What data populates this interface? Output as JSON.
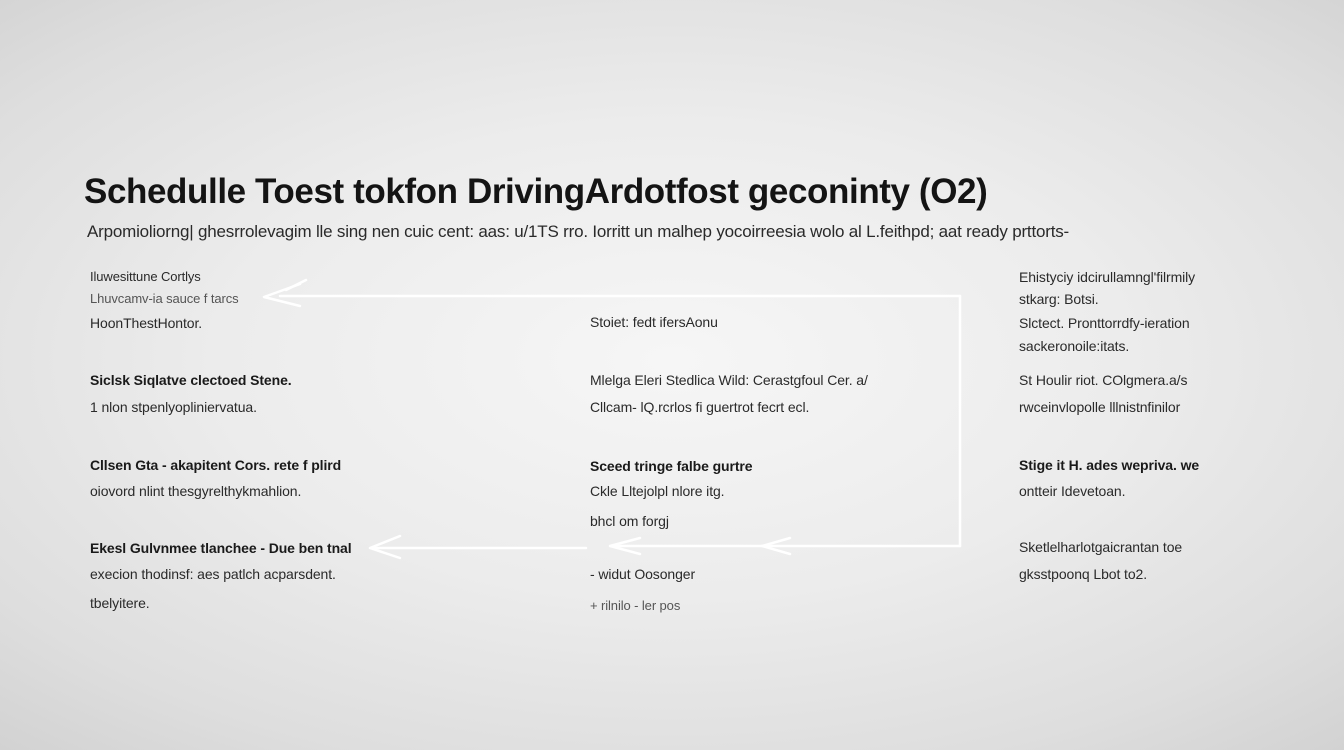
{
  "title": "Schedulle Toest  tokfon DrivingArdotfost geconinty  (O2)",
  "subtitle": "Arpomioliorng| ghesrrolevagim lle sing nen cuic cent: aas: u/1TS rro. Iorritt un malhep yocoirreesia wolo al  L.feithpd; aat ready prttorts-",
  "left_column": [
    "Iluwesittune Cortlys",
    "Lhuvcamv-ia sauce f tarcs",
    "HoonThestHontor.",
    "Siclsk Siqlatve clectoed Stene.",
    "1 nlon stpenlyopliniervatua.",
    "Cllsen Gta - akapitent Cors. rete f plird",
    "oiovord nlint thesgyrelthykmahlion.",
    "Ekesl Gulvnmee tlanchee - Due ben tnal",
    "execion thodinsf: aes patlch acparsdent.",
    "tbelyitere."
  ],
  "middle_column": [
    "Stoiet: fedt ifersAonu",
    "Mlelga Eleri Stedlica  Wild: Cerastgfoul Cer. a/",
    "Cllcam- lQ.rcrlos fi guertrot fecrt ecl.",
    "Sceed tringe falbe gurtre",
    "Ckle Lltejolpl nlore itg.",
    "bhcl om forgj",
    "- widut  Oosonger",
    "+ rilnilo - ler pos"
  ],
  "right_column": [
    "Ehistyciy idcirullamngl'filrmily",
    "stkarg: Botsi.",
    "Slctect. Pronttorrdfy-ieration",
    "sackeronoile:itats.",
    "St Houlir riot. COlgmera.a/s",
    "rwceinvlopolle lllnistnfinilor",
    "Stige it H. ades wepriva. we",
    "ontteir Idevetoan.",
    "Sketlelharlotgaicrantan toe",
    "gksstpoonq Lbot to2."
  ]
}
